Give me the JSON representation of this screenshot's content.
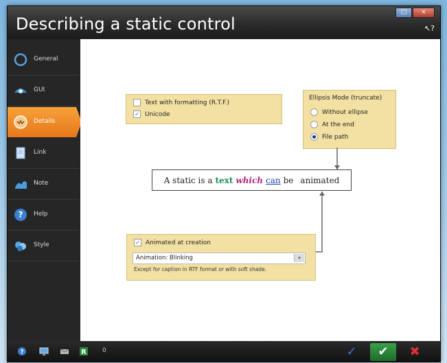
{
  "window": {
    "title": "Describing a static control",
    "help_cursor_glyph": "↖?",
    "controls": {
      "maximize": "□",
      "close": "×"
    }
  },
  "sidebar": {
    "items": [
      {
        "label": "General",
        "icon": "ring-icon"
      },
      {
        "label": "GUI",
        "icon": "eye-icon"
      },
      {
        "label": "Details",
        "icon": "mask-icon",
        "active": true
      },
      {
        "label": "Link",
        "icon": "document-icon"
      },
      {
        "label": "Note",
        "icon": "note-icon"
      },
      {
        "label": "Help",
        "icon": "help-icon"
      },
      {
        "label": "Style",
        "icon": "style-icon"
      }
    ]
  },
  "format_box": {
    "rtf_label": "Text with formatting (R.T.F.)",
    "rtf_checked": false,
    "unicode_label": "Unicode",
    "unicode_checked": true
  },
  "ellipsis_box": {
    "title": "Ellipsis Mode (truncate)",
    "options": [
      {
        "label": "Without ellipse",
        "selected": false
      },
      {
        "label": "At the end",
        "selected": false
      },
      {
        "label": "File path",
        "selected": true
      }
    ]
  },
  "preview": {
    "w1": "A static is a",
    "w2": "text",
    "w3": "which",
    "w4": "can",
    "w5": "be",
    "w6": "animated"
  },
  "animation_box": {
    "checkbox_label": "Animated at creation",
    "checked": true,
    "dropdown_value": "Animation: Blinking",
    "note": "Except for caption in RTF format or with soft shade."
  },
  "taskbar": {
    "count": "0",
    "icons": [
      "help-icon",
      "monitor-icon",
      "mail-icon",
      "r-icon"
    ]
  },
  "actions": {
    "dropdown_glyph": "✓",
    "ok_glyph": "✔",
    "cancel_glyph": "✖"
  },
  "colors": {
    "active_tab": "#f39a32",
    "option_box": "#f3e1a3",
    "ok_button": "#2e8b3e",
    "cancel": "#e03030"
  }
}
